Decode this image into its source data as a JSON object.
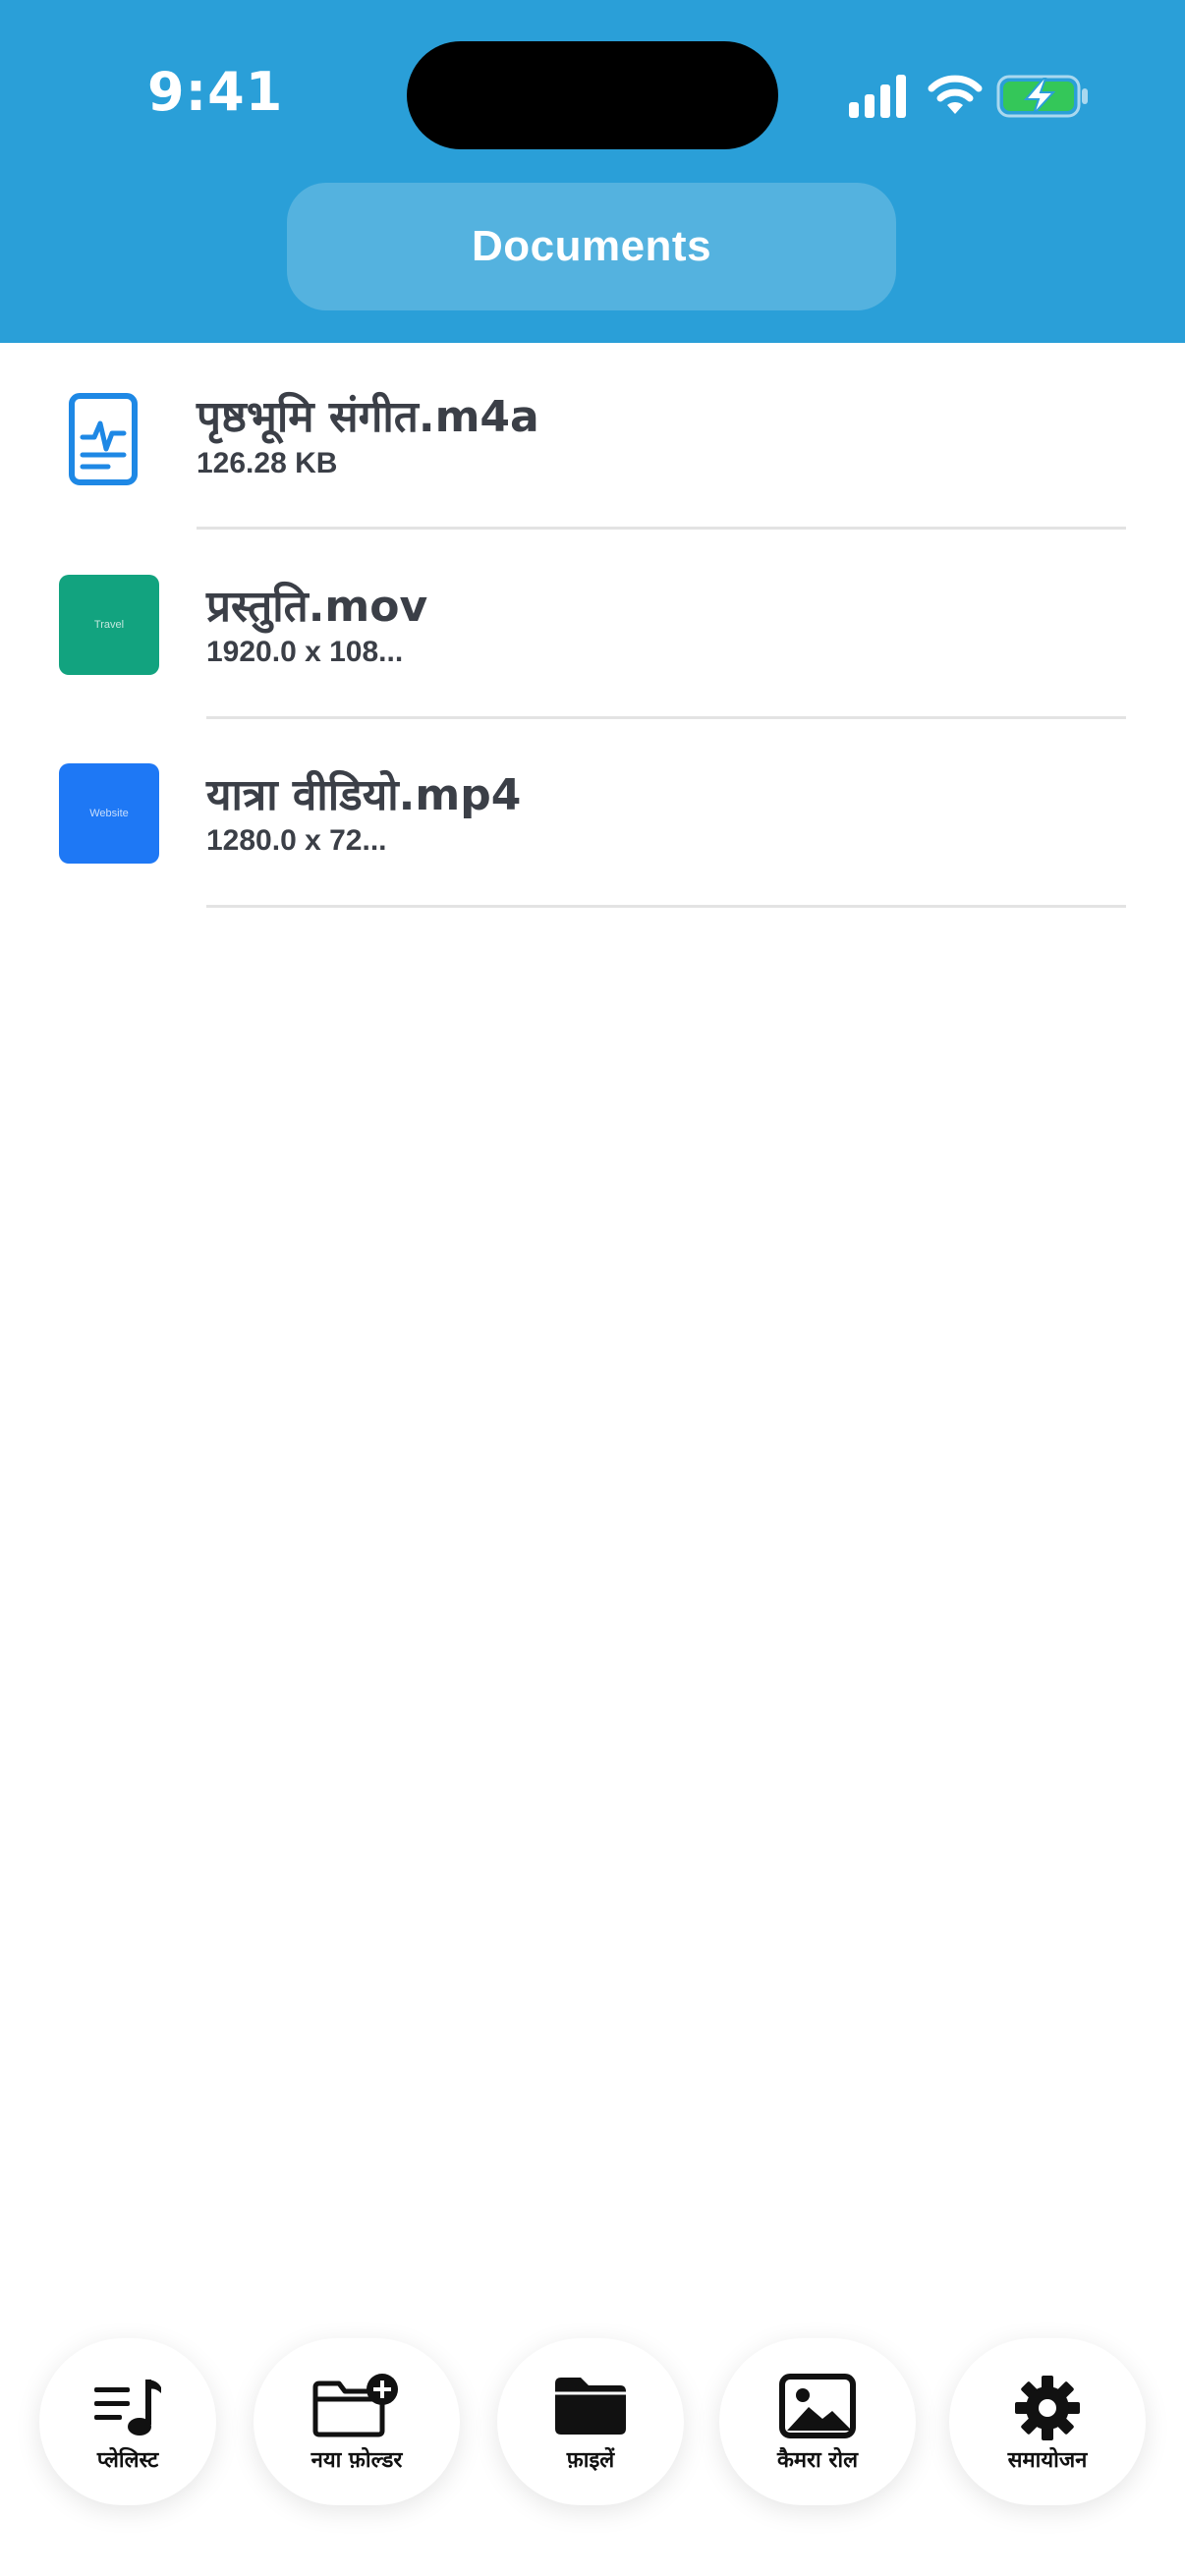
{
  "status_bar": {
    "time": "9:41",
    "icons": [
      "signal-icon",
      "wifi-icon",
      "battery-charging-icon"
    ],
    "battery_color": "#34c759"
  },
  "header": {
    "title": "Documents",
    "background": "#2a9fd8"
  },
  "files": [
    {
      "name": "पृष्ठभूमि संगीत.m4a",
      "meta": "126.28 KB",
      "icon": "audio-document-icon"
    },
    {
      "name": "प्रस्तुति.mov",
      "meta": "1920.0 x 108...",
      "thumb_text": "Travel",
      "thumb_color": "#12a37f"
    },
    {
      "name": "यात्रा वीडियो.mp4",
      "meta": "1280.0 x 72...",
      "thumb_text": "Website",
      "thumb_color": "#1e78f5"
    }
  ],
  "tabs": [
    {
      "label": "प्लेलिस्ट",
      "icon": "playlist-icon"
    },
    {
      "label": "नया फ़ोल्डर",
      "icon": "new-folder-icon"
    },
    {
      "label": "फ़ाइलें",
      "icon": "folder-icon"
    },
    {
      "label": "कैमरा रोल",
      "icon": "photo-icon"
    },
    {
      "label": "समायोजन",
      "icon": "gear-icon"
    }
  ]
}
